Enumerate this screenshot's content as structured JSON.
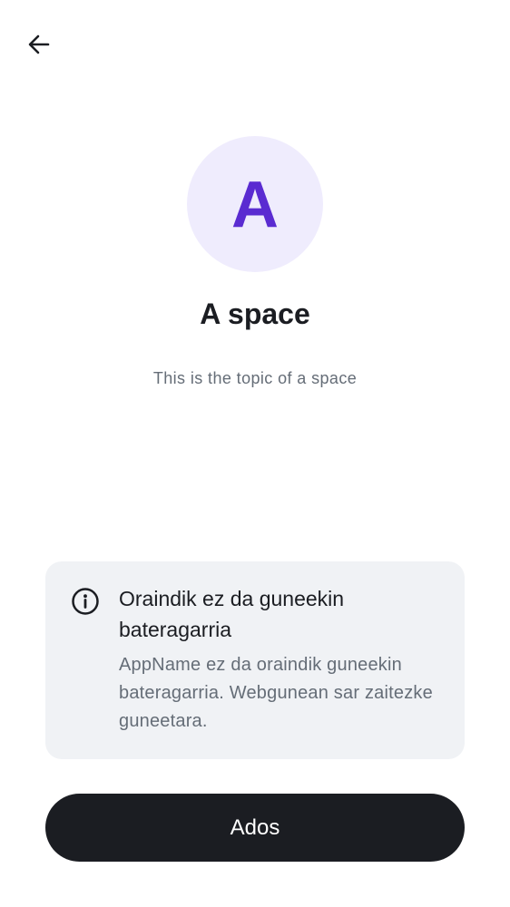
{
  "header": {
    "back_icon": "arrow-left-icon"
  },
  "space": {
    "avatar_letter": "A",
    "name": "A space",
    "topic": "This is the topic of a space"
  },
  "notice": {
    "icon": "info-icon",
    "title": "Oraindik ez da guneekin bateragarria",
    "body": "AppName ez da oraindik guneekin bateragarria. Webgunean sar zaitezke guneetara."
  },
  "actions": {
    "ok_label": "Ados"
  },
  "colors": {
    "accent": "#5a2bd1",
    "avatar_background": "#efecfd",
    "text_primary": "#1b1d22",
    "text_secondary": "#656d77",
    "card_background": "#f0f2f5",
    "button_background": "#1b1d22",
    "button_text": "#ffffff"
  }
}
